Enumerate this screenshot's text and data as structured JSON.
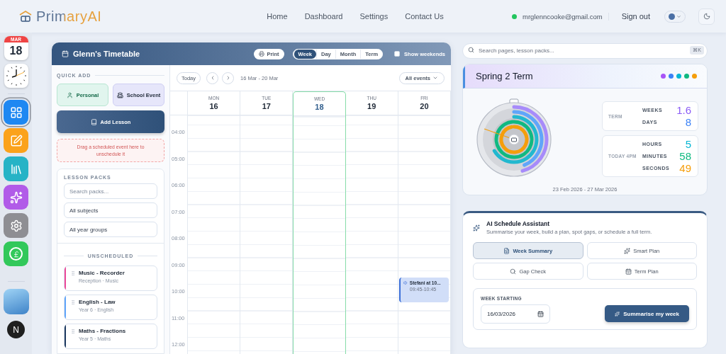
{
  "header": {
    "logo": "PrimaryAI",
    "nav": [
      {
        "label": "Home"
      },
      {
        "label": "Dashboard"
      },
      {
        "label": "Settings"
      },
      {
        "label": "Contact Us"
      }
    ],
    "user": {
      "email": "mrglenncooke@gmail.com",
      "online": true
    },
    "sign_out": "Sign out"
  },
  "dock": {
    "calendar": {
      "month": "MAR",
      "day": "18"
    },
    "apps": [
      {
        "kind": "grid",
        "selected": true
      },
      {
        "kind": "edit",
        "selected": false
      },
      {
        "kind": "library",
        "selected": false
      },
      {
        "kind": "sparkles",
        "selected": false
      },
      {
        "kind": "settings",
        "selected": false
      },
      {
        "kind": "pound",
        "selected": false
      }
    ],
    "badge": "N"
  },
  "timetable": {
    "title": "Glenn's Timetable",
    "print": "Print",
    "views": [
      {
        "label": "Week",
        "selected": true
      },
      {
        "label": "Day",
        "selected": false
      },
      {
        "label": "Month",
        "selected": false
      },
      {
        "label": "Term",
        "selected": false
      }
    ],
    "show_weekends": {
      "label": "Show weekends",
      "checked": false
    },
    "quick_add": {
      "heading": "QUICK ADD",
      "personal": "Personal",
      "school_event": "School Event",
      "add_lesson": "Add Lesson",
      "drop_hint": "Drag a scheduled event here to unschedule it"
    },
    "lesson_packs": {
      "heading": "LESSON PACKS",
      "search_placeholder": "Search packs...",
      "subjects": "All subjects",
      "year_groups": "All year groups",
      "divider": "UNSCHEDULED",
      "items": [
        {
          "title": "Music - Recorder",
          "meta": "Reception · Music",
          "color": "#ec4899"
        },
        {
          "title": "English - Law",
          "meta": "Year 6 · English",
          "color": "#60a5fa"
        },
        {
          "title": "Maths - Fractions",
          "meta": "Year 5 · Maths",
          "color": "#1e3a5f"
        }
      ]
    },
    "toolbar": {
      "today": "Today",
      "range": "16 Mar - 20 Mar",
      "filter": "All events"
    },
    "times": [
      "04:00",
      "05:00",
      "06:00",
      "07:00",
      "08:00",
      "09:00",
      "10:00",
      "11:00",
      "12:00"
    ],
    "days": [
      {
        "dow": "MON",
        "date": "16",
        "today": false
      },
      {
        "dow": "TUE",
        "date": "17",
        "today": false
      },
      {
        "dow": "WED",
        "date": "18",
        "today": true
      },
      {
        "dow": "THU",
        "date": "19",
        "today": false
      },
      {
        "dow": "FRI",
        "date": "20",
        "today": false,
        "events": [
          {
            "title": "Stefani at 10...",
            "time": "09:45-10:45"
          }
        ]
      }
    ]
  },
  "search": {
    "placeholder": "Search pages, lesson packs...",
    "shortcut": "⌘K"
  },
  "term": {
    "title": "Spring 2 Term",
    "dots": [
      {
        "color": "#a855f7"
      },
      {
        "color": "#3b82f6"
      },
      {
        "color": "#06b6d4"
      },
      {
        "color": "#10b981"
      },
      {
        "color": "#f59e0b"
      }
    ],
    "groups": [
      {
        "label": "TERM",
        "stats": [
          {
            "label": "WEEKS",
            "value": "1.6",
            "color": "#8b5cf6"
          },
          {
            "label": "DAYS",
            "value": "8",
            "color": "#3b82f6"
          }
        ]
      },
      {
        "label": "TODAY 4PM",
        "stats": [
          {
            "label": "HOURS",
            "value": "5",
            "color": "#06b6d4"
          },
          {
            "label": "MINUTES",
            "value": "58",
            "color": "#10b981"
          },
          {
            "label": "SECONDS",
            "value": "49",
            "color": "#f59e0b"
          }
        ]
      }
    ],
    "dates": "23 Feb 2026 - 27 Mar 2026"
  },
  "assistant": {
    "title": "AI Schedule Assistant",
    "subtitle": "Summarise your week, build a plan, spot gaps, or schedule a full term.",
    "modes": [
      {
        "kind": "summary",
        "label": "Week Summary",
        "selected": true
      },
      {
        "kind": "plan",
        "label": "Smart Plan",
        "selected": false
      },
      {
        "kind": "gaps",
        "label": "Gap Check",
        "selected": false
      },
      {
        "kind": "term",
        "label": "Term Plan",
        "selected": false
      }
    ],
    "week_label": "WEEK STARTING",
    "week_value": "16/03/2026",
    "action": "Summarise my week"
  }
}
